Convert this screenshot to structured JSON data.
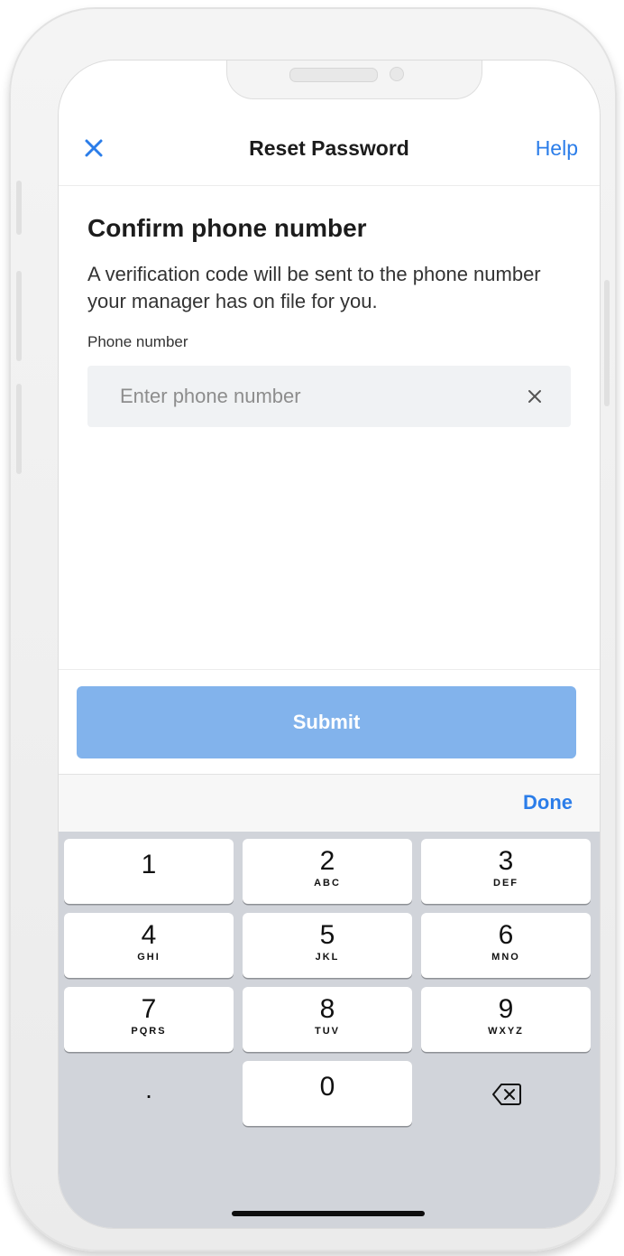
{
  "nav": {
    "title": "Reset Password",
    "help_label": "Help",
    "close_icon": "close-icon"
  },
  "form": {
    "heading": "Confirm phone number",
    "description": "A verification code will be sent to the phone number your manager has on file for you.",
    "field_label": "Phone number",
    "phone_placeholder": "Enter phone number",
    "phone_value": ""
  },
  "submit_label": "Submit",
  "keyboard": {
    "done_label": "Done",
    "keys": [
      {
        "digit": "1",
        "letters": ""
      },
      {
        "digit": "2",
        "letters": "ABC"
      },
      {
        "digit": "3",
        "letters": "DEF"
      },
      {
        "digit": "4",
        "letters": "GHI"
      },
      {
        "digit": "5",
        "letters": "JKL"
      },
      {
        "digit": "6",
        "letters": "MNO"
      },
      {
        "digit": "7",
        "letters": "PQRS"
      },
      {
        "digit": "8",
        "letters": "TUV"
      },
      {
        "digit": "9",
        "letters": "WXYZ"
      }
    ],
    "dot_key": ".",
    "zero_key": "0",
    "backspace_icon": "backspace-icon"
  },
  "colors": {
    "accent": "#2b7de9",
    "submit_disabled": "#82b3ec",
    "keypad_bg": "#d1d4da"
  }
}
